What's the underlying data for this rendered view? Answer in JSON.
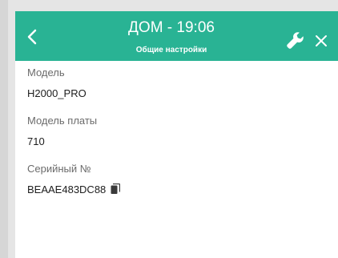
{
  "header": {
    "title": "ДОМ - 19:06",
    "subtitle": "Общие настройки",
    "back_icon": "chevron-left-icon",
    "settings_icon": "wrench-icon",
    "close_icon": "close-icon",
    "background_color": "#29b394"
  },
  "fields": [
    {
      "label": "Модель",
      "value": "H2000_PRO"
    },
    {
      "label": "Модель платы",
      "value": "710"
    },
    {
      "label": "Серийный №",
      "value": "BEAAE483DC88"
    }
  ],
  "copy_icon": "copy-icon"
}
